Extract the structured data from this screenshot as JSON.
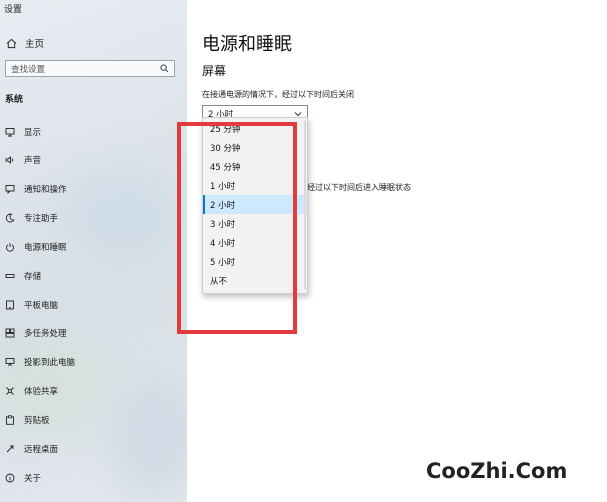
{
  "window": {
    "title": "设置"
  },
  "sidebar": {
    "home_label": "主页",
    "search_placeholder": "查找设置",
    "section_label": "系统",
    "items": [
      {
        "label": "显示",
        "icon": "monitor-icon"
      },
      {
        "label": "声音",
        "icon": "speaker-icon"
      },
      {
        "label": "通知和操作",
        "icon": "message-icon"
      },
      {
        "label": "专注助手",
        "icon": "moon-icon"
      },
      {
        "label": "电源和睡眠",
        "icon": "power-icon"
      },
      {
        "label": "存储",
        "icon": "storage-icon"
      },
      {
        "label": "平板电脑",
        "icon": "tablet-icon"
      },
      {
        "label": "多任务处理",
        "icon": "multitask-icon"
      },
      {
        "label": "投影到此电脑",
        "icon": "project-icon"
      },
      {
        "label": "体验共享",
        "icon": "share-icon"
      },
      {
        "label": "剪贴板",
        "icon": "clipboard-icon"
      },
      {
        "label": "远程桌面",
        "icon": "remote-icon"
      },
      {
        "label": "关于",
        "icon": "info-icon"
      }
    ]
  },
  "main": {
    "title": "电源和睡眠",
    "screen_section": "屏幕",
    "screen_label": "在接通电源的情况下，经过以下时间后关闭",
    "screen_select_value": "2 小时",
    "sleep_label": "经过以下时间后进入睡眠状态",
    "dropdown_options": [
      "25 分钟",
      "30 分钟",
      "45 分钟",
      "1 小时",
      "2 小时",
      "3 小时",
      "4 小时",
      "5 小时",
      "从不"
    ],
    "selected_option": "2 小时"
  },
  "watermark": "CooZhi.Com",
  "colors": {
    "accent": "#0078d7",
    "selection": "#cde8ff",
    "annotation_red": "#e23b3b"
  }
}
